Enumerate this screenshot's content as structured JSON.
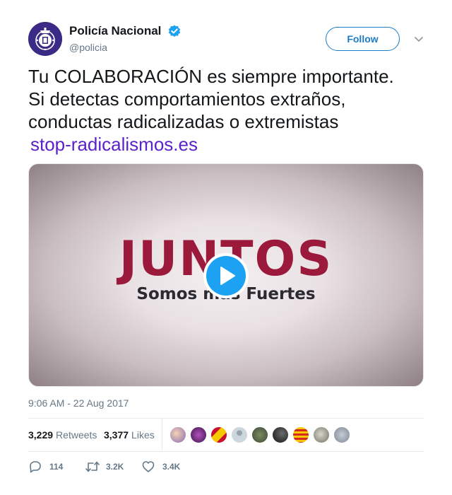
{
  "author": {
    "display_name": "Policía Nacional",
    "handle": "@policia",
    "verified": true,
    "avatar_icon": "police-badge-icon"
  },
  "header": {
    "follow_label": "Follow",
    "menu_icon": "chevron-down-icon"
  },
  "tweet": {
    "text_lines": [
      "Tu COLABORACIÓN es siempre importante.",
      "Si detectas comportamientos extraños,",
      "conductas radicalizadas o extremistas"
    ],
    "link": "stop-radicalismos.es"
  },
  "media": {
    "title": "JUNTOS",
    "subtitle": "Somos más Fuertes",
    "play_icon": "play-icon"
  },
  "timestamp": "9:06 AM - 22 Aug 2017",
  "stats": {
    "retweets_count": "3,229",
    "retweets_label": "Retweets",
    "likes_count": "3,377",
    "likes_label": "Likes"
  },
  "actions": {
    "replies": "114",
    "retweets": "3.2K",
    "likes": "3.4K"
  },
  "colors": {
    "accent": "#1da1f2",
    "follow": "#1b7cc8",
    "link": "#5b22cc",
    "video_title": "#9b1a3c"
  }
}
